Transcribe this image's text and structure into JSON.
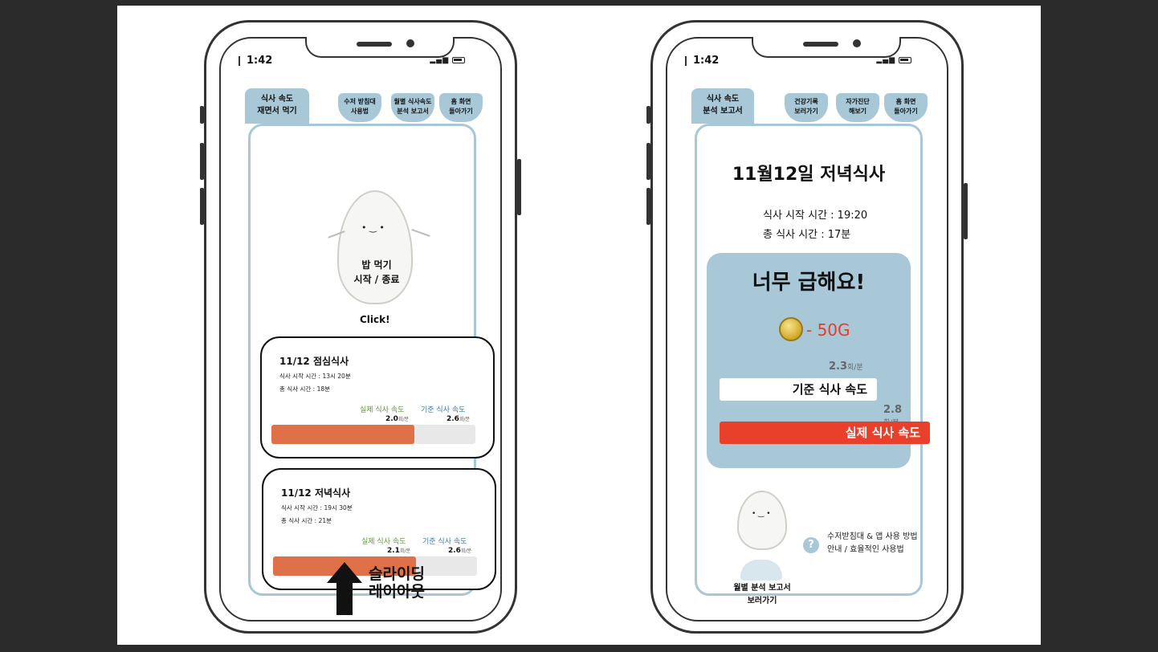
{
  "left_phone": {
    "time": "1:42",
    "status_icons": "▂▄▆",
    "tabs": {
      "active": "식사 속도\n재면서 먹기",
      "bowls": [
        "수저 받침대\n사용법",
        "월별 식사속도\n분석 보고서",
        "홈 화면\n돌아가기"
      ]
    },
    "character": {
      "face": "• ‿ •",
      "text": "밥 먹기\n시작 / 종료",
      "click": "Click!"
    },
    "cards": [
      {
        "title": "11/12 점심식사",
        "start_time": "식사 시작 시간 : 13시 20분",
        "total_time": "총 식사 시간 : 18분",
        "actual_label": "실제 식사 속도",
        "std_label": "기준 식사 속도",
        "actual_value": "2.0",
        "std_value": "2.6",
        "unit": "회/분",
        "fill_fraction": 0.7
      },
      {
        "title": "11/12 저녁식사",
        "start_time": "식사 시작 시간 : 19시 30분",
        "total_time": "총 식사 시간 : 21분",
        "actual_label": "실제 식사 속도",
        "std_label": "기준 식사 속도",
        "actual_value": "2.1",
        "std_value": "2.6",
        "unit": "회/분",
        "fill_fraction": 0.7
      }
    ],
    "slide_label": "슬라이딩\n레이아웃"
  },
  "right_phone": {
    "time": "1:42",
    "status_icons": "▂▄▆",
    "tabs": {
      "active": "식사 속도\n분석 보고서",
      "bowls": [
        "건강기록\n보러가기",
        "자가진단\n해보기",
        "홈 화면\n돌아가기"
      ]
    },
    "title": "11월12일 저녁식사",
    "start_time": "식사 시작 시간 : 19:20",
    "total_time": "총 식사 시간 :     17분",
    "panel": {
      "headline": "너무 급해요!",
      "coin_text": "- 50G",
      "std_value": "2.3",
      "actual_value": "2.8",
      "unit": "회/분",
      "std_label": "기준 식사 속도",
      "actual_label": "실제 식사 속도"
    },
    "help": {
      "icon": "?",
      "text": "수저받침대 & 앱 사용 방법\n안내 / 효율적인 사용법"
    },
    "monthly": "월별 분석 보고서\n보러가기",
    "face": "• ‿ •"
  }
}
